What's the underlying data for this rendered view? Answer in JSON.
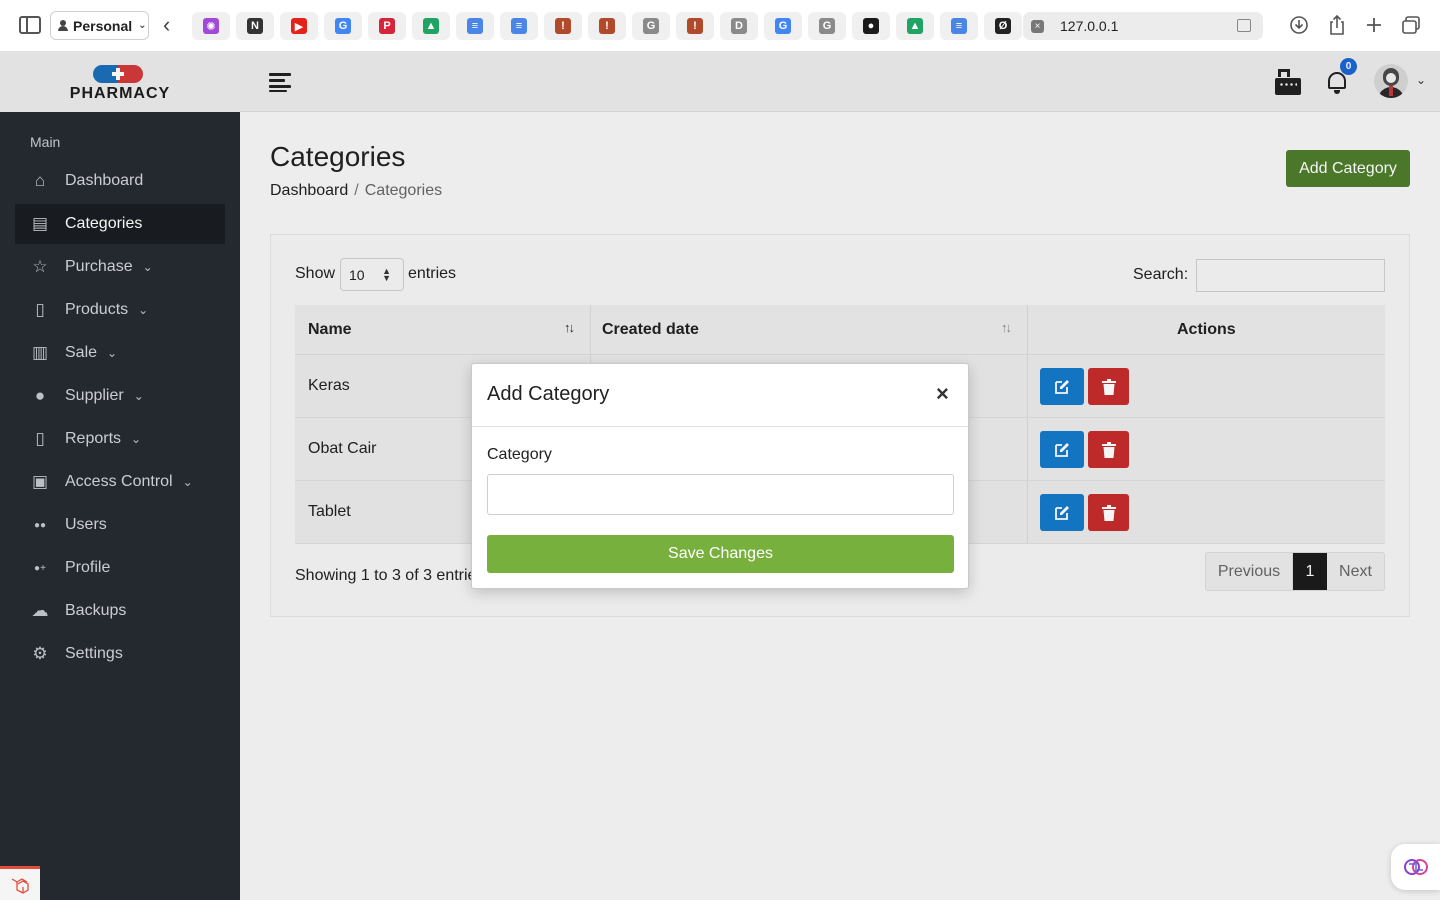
{
  "browser": {
    "profile": "Personal",
    "url": "127.0.0.1",
    "tabs": [
      {
        "name": "brain-tab-icon",
        "color": "#a24ad6",
        "glyph": "✺"
      },
      {
        "name": "notion-tab-icon",
        "color": "#333333",
        "glyph": "N"
      },
      {
        "name": "youtube-tab-icon",
        "color": "#e62117",
        "glyph": "▶"
      },
      {
        "name": "google-tab-icon",
        "color": "#4285f4",
        "glyph": "G"
      },
      {
        "name": "pinterest-tab-icon",
        "color": "#d5253a",
        "glyph": "P"
      },
      {
        "name": "drive-tab-icon",
        "color": "#1fa463",
        "glyph": "▲"
      },
      {
        "name": "docs-tab-icon",
        "color": "#4a86e8",
        "glyph": "≡"
      },
      {
        "name": "docs-tab-icon-2",
        "color": "#4a86e8",
        "glyph": "≡"
      },
      {
        "name": "figure-tab-icon",
        "color": "#b04a2a",
        "glyph": "!"
      },
      {
        "name": "figure-tab-icon-2",
        "color": "#b04a2a",
        "glyph": "!"
      },
      {
        "name": "g-gray-tab-icon",
        "color": "#8a8a8a",
        "glyph": "G"
      },
      {
        "name": "figure-tab-icon-3",
        "color": "#b04a2a",
        "glyph": "!"
      },
      {
        "name": "d-gray-tab-icon",
        "color": "#8a8a8a",
        "glyph": "D"
      },
      {
        "name": "google-tab-icon-2",
        "color": "#4285f4",
        "glyph": "G"
      },
      {
        "name": "g-gray-tab-icon-2",
        "color": "#8a8a8a",
        "glyph": "G"
      },
      {
        "name": "github-tab-icon",
        "color": "#1b1b1b",
        "glyph": "●"
      },
      {
        "name": "drive-tab-icon-2",
        "color": "#1fa463",
        "glyph": "▲"
      },
      {
        "name": "docs-tab-icon-3",
        "color": "#4a86e8",
        "glyph": "≡"
      },
      {
        "name": "slash-tab-icon",
        "color": "#222222",
        "glyph": "Ø"
      }
    ]
  },
  "header": {
    "logo_text": "PHARMACY",
    "notification_count": "0"
  },
  "sidebar": {
    "section_label": "Main",
    "items": [
      {
        "label": "Dashboard",
        "icon": "home-icon",
        "glyph": "⌂",
        "has_submenu": false,
        "active": false
      },
      {
        "label": "Categories",
        "icon": "layout-icon",
        "glyph": "▤",
        "has_submenu": false,
        "active": true
      },
      {
        "label": "Purchase",
        "icon": "star-icon",
        "glyph": "☆",
        "has_submenu": true,
        "active": false
      },
      {
        "label": "Products",
        "icon": "document-icon",
        "glyph": "▯",
        "has_submenu": true,
        "active": false
      },
      {
        "label": "Sale",
        "icon": "bar-chart-icon",
        "glyph": "▥",
        "has_submenu": true,
        "active": false
      },
      {
        "label": "Supplier",
        "icon": "user-icon",
        "glyph": "●",
        "has_submenu": true,
        "active": false
      },
      {
        "label": "Reports",
        "icon": "report-icon",
        "glyph": "▯",
        "has_submenu": true,
        "active": false
      },
      {
        "label": "Access Control",
        "icon": "lock-icon",
        "glyph": "▣",
        "has_submenu": true,
        "active": false
      },
      {
        "label": "Users",
        "icon": "users-icon",
        "glyph": "●●",
        "has_submenu": false,
        "active": false
      },
      {
        "label": "Profile",
        "icon": "user-plus-icon",
        "glyph": "●+",
        "has_submenu": false,
        "active": false
      },
      {
        "label": "Backups",
        "icon": "cloud-upload-icon",
        "glyph": "☁",
        "has_submenu": false,
        "active": false
      },
      {
        "label": "Settings",
        "icon": "gear-icon",
        "glyph": "⚙",
        "has_submenu": false,
        "active": false
      }
    ]
  },
  "page": {
    "title": "Categories",
    "breadcrumb": {
      "home": "Dashboard",
      "separator": "/",
      "current": "Categories"
    },
    "add_button": "Add Category"
  },
  "table": {
    "show_label": "Show",
    "entries_value": "10",
    "entries_label": "entries",
    "search_label": "Search:",
    "columns": [
      "Name",
      "Created date",
      "Actions"
    ],
    "rows": [
      {
        "name": "Keras"
      },
      {
        "name": "Obat Cair"
      },
      {
        "name": "Tablet"
      }
    ],
    "info": "Showing 1 to 3 of 3 entries",
    "pagination": {
      "previous": "Previous",
      "current": "1",
      "next": "Next"
    }
  },
  "modal": {
    "title": "Add Category",
    "close": "×",
    "field_label": "Category",
    "field_value": "",
    "submit": "Save Changes"
  },
  "colors": {
    "sidebar_bg": "#262a31",
    "add_button": "#4e7c2b",
    "save_button": "#78b03d",
    "edit_button": "#1479c9",
    "delete_button": "#c62b2b"
  }
}
